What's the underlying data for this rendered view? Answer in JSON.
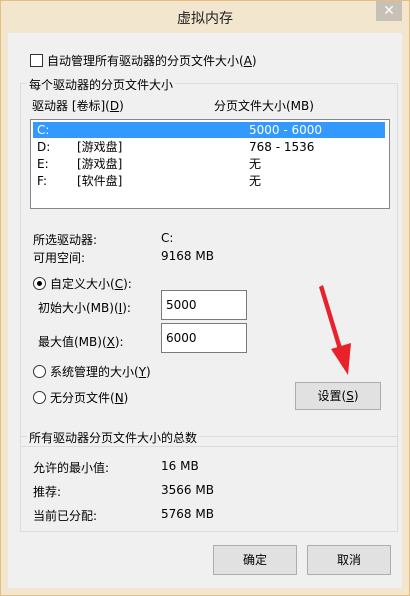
{
  "window": {
    "title": "虚拟内存",
    "close_glyph": "✕"
  },
  "auto_manage": {
    "label_prefix": "自动管理所有驱动器的分页文件大小(",
    "hotkey": "A",
    "label_suffix": ")"
  },
  "drives_group": {
    "title": "每个驱动器的分页文件大小",
    "col_drive_prefix": "驱动器 [卷标](",
    "col_drive_hotkey": "D",
    "col_drive_suffix": ")",
    "col_size": "分页文件大小(MB)",
    "rows": [
      {
        "drive": "C:",
        "label": "",
        "size": "5000 - 6000"
      },
      {
        "drive": "D:",
        "label": "[游戏盘]",
        "size": "768 - 1536"
      },
      {
        "drive": "E:",
        "label": "[游戏盘]",
        "size": "无"
      },
      {
        "drive": "F:",
        "label": "[软件盘]",
        "size": "无"
      }
    ],
    "selected_drive_label": "所选驱动器:",
    "selected_drive_value": "C:",
    "free_space_label": "可用空间:",
    "free_space_value": "9168 MB",
    "custom_prefix": "自定义大小(",
    "custom_hotkey": "C",
    "custom_suffix": "):",
    "initial_prefix": "初始大小(MB)(",
    "initial_hotkey": "I",
    "initial_suffix": "):",
    "initial_value": "5000",
    "max_prefix": "最大值(MB)(",
    "max_hotkey": "X",
    "max_suffix": "):",
    "max_value": "6000",
    "system_prefix": "系统管理的大小(",
    "system_hotkey": "Y",
    "system_suffix": ")",
    "none_prefix": "无分页文件(",
    "none_hotkey": "N",
    "none_suffix": ")",
    "set_prefix": "设置(",
    "set_hotkey": "S",
    "set_suffix": ")"
  },
  "total_group": {
    "title": "所有驱动器分页文件大小的总数",
    "min_label": "允许的最小值:",
    "min_value": "16 MB",
    "recommended_label": "推荐:",
    "recommended_value": "3566 MB",
    "current_label": "当前已分配:",
    "current_value": "5768 MB"
  },
  "buttons": {
    "ok": "确定",
    "cancel": "取消"
  },
  "colors": {
    "selection": "#3399ff",
    "arrow": "#e8212a",
    "frame": "#e8bc7d"
  }
}
